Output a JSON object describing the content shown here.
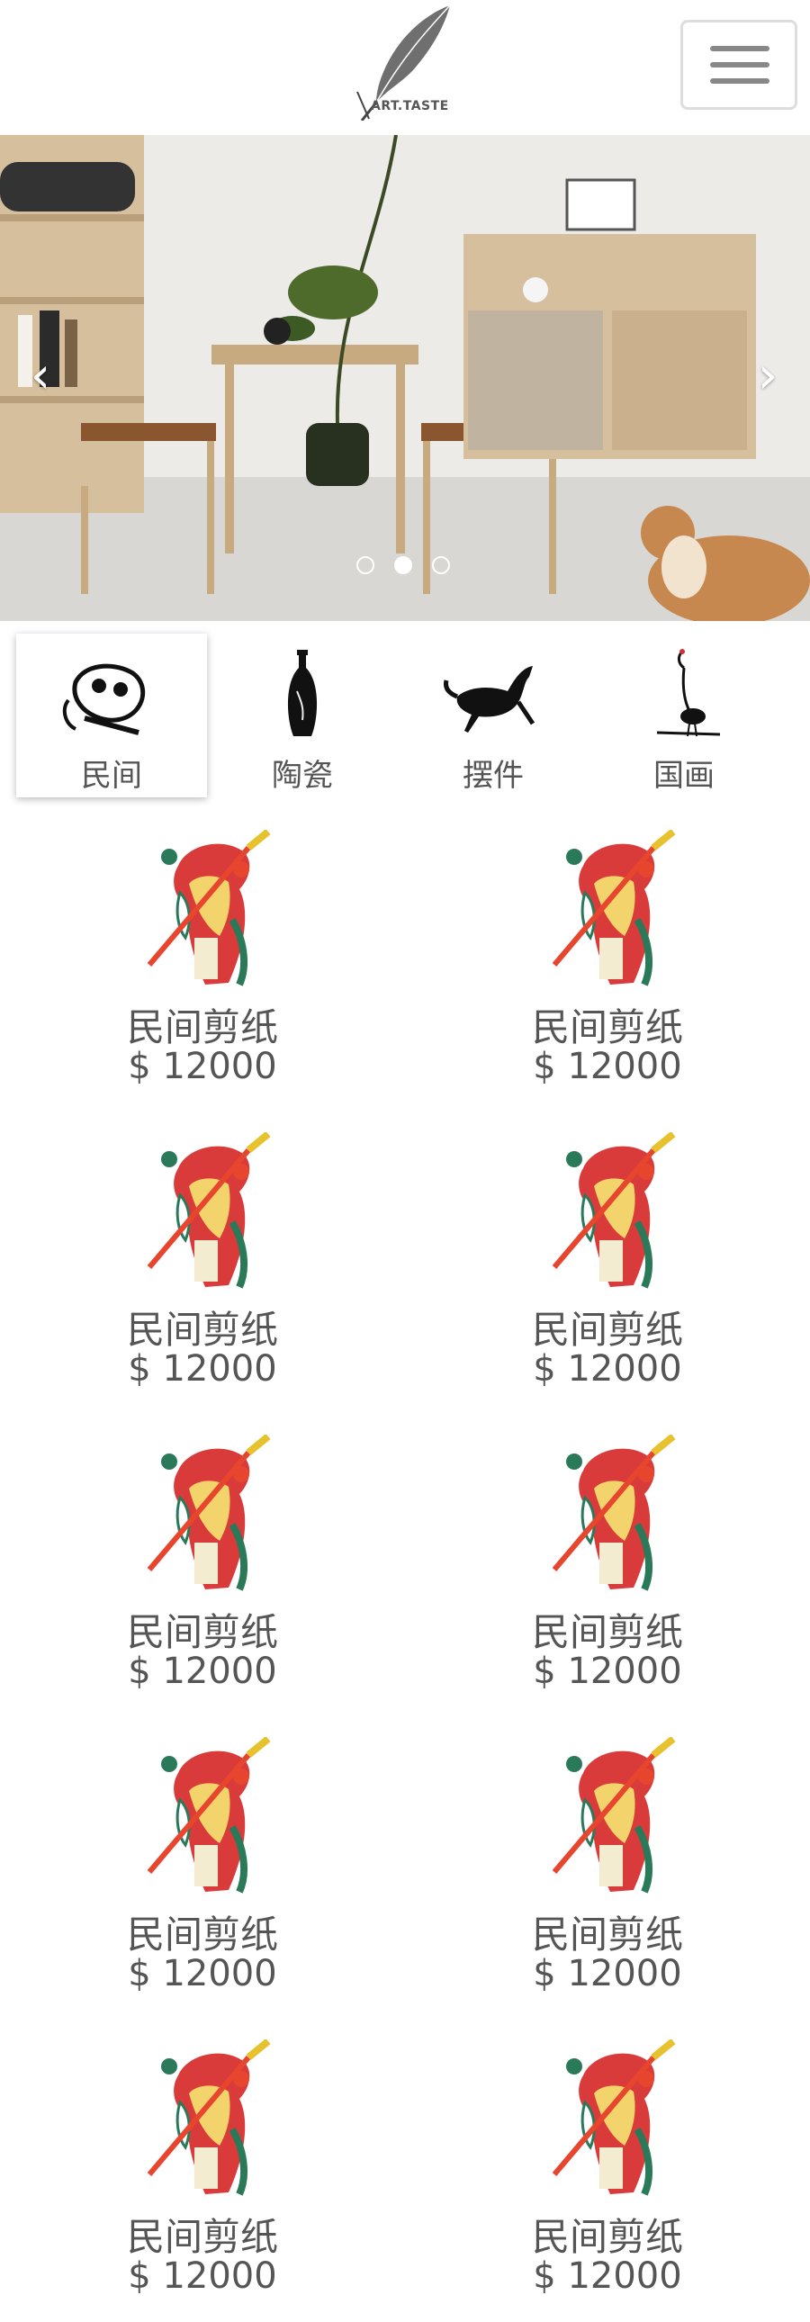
{
  "header": {
    "logo_text": "ART.TASTE",
    "menu_icon": "hamburger-menu-icon"
  },
  "carousel": {
    "prev_icon": "chevron-left-icon",
    "next_icon": "chevron-right-icon",
    "prev_glyph": "‹",
    "next_glyph": "›",
    "slide_count": 3,
    "active_slide": 2
  },
  "categories": [
    {
      "label": "民间",
      "icon": "folk-art-icon",
      "active": true
    },
    {
      "label": "陶瓷",
      "icon": "ceramic-vase-icon",
      "active": false
    },
    {
      "label": "摆件",
      "icon": "horse-ornament-icon",
      "active": false
    },
    {
      "label": "国画",
      "icon": "crane-painting-icon",
      "active": false
    }
  ],
  "products": [
    {
      "name": "民间剪纸",
      "price": "$ 12000"
    },
    {
      "name": "民间剪纸",
      "price": "$ 12000"
    },
    {
      "name": "民间剪纸",
      "price": "$ 12000"
    },
    {
      "name": "民间剪纸",
      "price": "$ 12000"
    },
    {
      "name": "民间剪纸",
      "price": "$ 12000"
    },
    {
      "name": "民间剪纸",
      "price": "$ 12000"
    },
    {
      "name": "民间剪纸",
      "price": "$ 12000"
    },
    {
      "name": "民间剪纸",
      "price": "$ 12000"
    },
    {
      "name": "民间剪纸",
      "price": "$ 12000"
    },
    {
      "name": "民间剪纸",
      "price": "$ 12000"
    }
  ],
  "colors": {
    "text": "#555555",
    "menu_border": "#dddddd",
    "menu_bar": "#888888"
  }
}
